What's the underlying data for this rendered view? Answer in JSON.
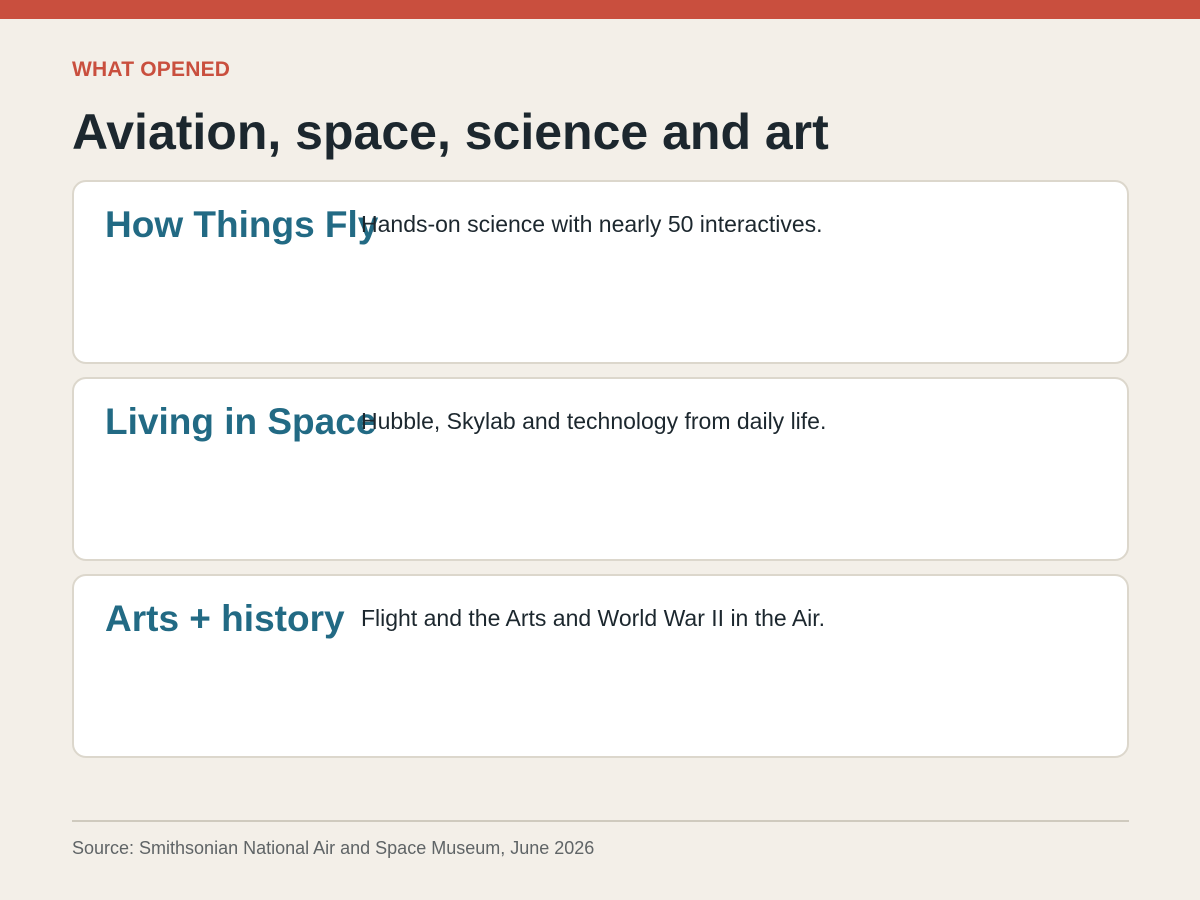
{
  "colors": {
    "accent": "#c94f3e",
    "card_title": "#226a84",
    "text": "#1c272e",
    "background": "#f3efe8"
  },
  "eyebrow": "WHAT OPENED",
  "title": "Aviation, space, science and art",
  "cards": [
    {
      "name": "How Things Fly",
      "description": "Hands-on science with nearly 50 interactives."
    },
    {
      "name": "Living in Space",
      "description": "Hubble, Skylab and technology from daily life."
    },
    {
      "name": "Arts + history",
      "description": "Flight and the Arts and World War II in the Air."
    }
  ],
  "source": "Source: Smithsonian National Air and Space Museum, June 2026"
}
